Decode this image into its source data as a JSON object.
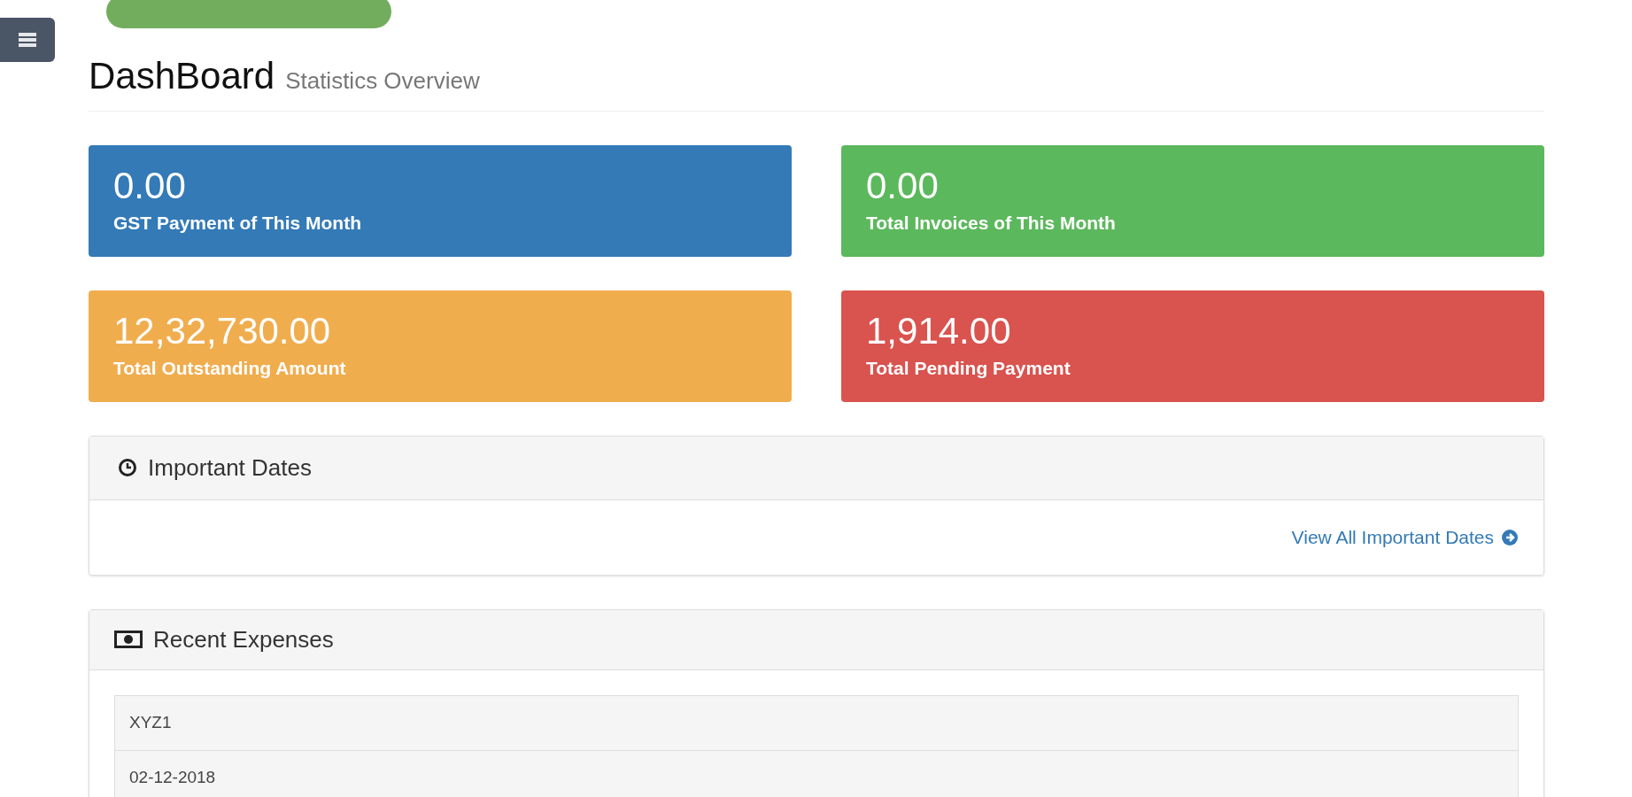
{
  "header": {
    "title": "DashBoard",
    "subtitle": "Statistics Overview"
  },
  "stats": [
    {
      "value": "0.00",
      "label": "GST Payment of This Month",
      "color": "#337ab7"
    },
    {
      "value": "0.00",
      "label": "Total Invoices of This Month",
      "color": "#5cb85c"
    },
    {
      "value": "12,32,730.00",
      "label": "Total Outstanding Amount",
      "color": "#f0ad4e"
    },
    {
      "value": "1,914.00",
      "label": "Total Pending Payment",
      "color": "#d9534f"
    }
  ],
  "important_dates": {
    "title": "Important Dates",
    "link": "View All Important Dates"
  },
  "recent_expenses": {
    "title": "Recent Expenses",
    "rows": [
      "XYZ1",
      "02-12-2018"
    ]
  }
}
